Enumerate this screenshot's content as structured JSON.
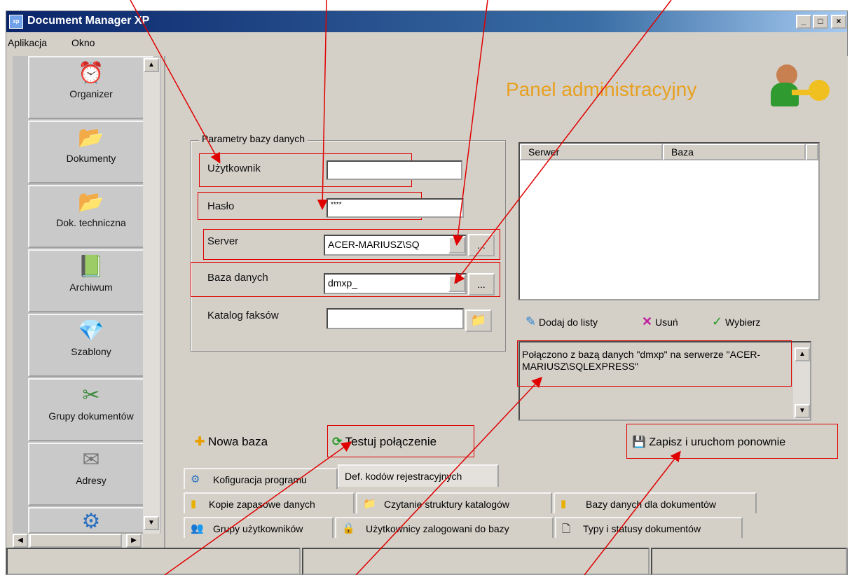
{
  "window": {
    "title": "Document Manager XP",
    "app_icon_text": "xp",
    "controls": [
      "_",
      "□",
      "×"
    ]
  },
  "menu": [
    "Aplikacja",
    "Okno"
  ],
  "sidebar": {
    "items": [
      {
        "label": "Organizer",
        "icon": "organizer-icon",
        "glyph": "⏰"
      },
      {
        "label": "Dokumenty",
        "icon": "folder-icon",
        "glyph": "📂"
      },
      {
        "label": "Dok. techniczna",
        "icon": "tech-folder-icon",
        "glyph": "📂"
      },
      {
        "label": "Archiwum",
        "icon": "archive-book-icon",
        "glyph": "📗"
      },
      {
        "label": "Szablony",
        "icon": "template-icon",
        "glyph": "💎"
      },
      {
        "label": "Grupy dokumentów",
        "icon": "groups-icon",
        "glyph": "✂"
      },
      {
        "label": "Adresy",
        "icon": "address-icon",
        "glyph": "✉"
      },
      {
        "label": "",
        "icon": "settings-icon",
        "glyph": "⚙"
      }
    ]
  },
  "panel": {
    "title": "Panel administracyjny",
    "group_title": "Parametry bazy danych",
    "user_label": "Użytkownik",
    "user_value": "",
    "password_label": "Hasło",
    "password_value": "****",
    "server_label": "Server",
    "server_value": "ACER-MARIUSZ\\SQ",
    "database_label": "Baza danych",
    "database_value": "dmxp_",
    "fax_label": "Katalog faksów",
    "fax_value": "",
    "browse_label": "...",
    "list_headers": [
      "Serwer",
      "Baza"
    ],
    "add_label": "Dodaj do listy",
    "remove_label": "Usuń",
    "choose_label": "Wybierz",
    "status_message": "Połączono z bazą danych \"dmxp\" na serwerze \"ACER-MARIUSZ\\SQLEXPRESS\"",
    "new_db_label": "Nowa baza",
    "test_label": "Testuj połączenie",
    "save_label": "Zapisz i uruchom ponownie"
  },
  "tabs": {
    "row1": [
      "Kofiguracja programu",
      "Def. kodów rejestracyjnych"
    ],
    "row2": [
      "Kopie zapasowe danych",
      "Czytanie struktury katalogów",
      "Bazy danych dla dokumentów"
    ],
    "row3": [
      "Grupy użytkowników",
      "Użytkownicy zalogowani do bazy",
      "Typy i statusy dokumentów"
    ]
  },
  "colors": {
    "annotation": "#e00000",
    "panel_title": "#e8a020",
    "titlebar": "#0a246a"
  }
}
